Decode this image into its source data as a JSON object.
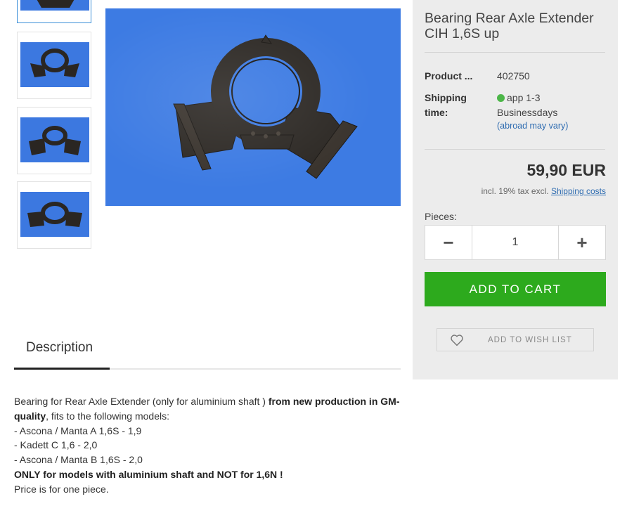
{
  "product": {
    "title": "Bearing Rear Axle Extender CIH 1,6S up",
    "number_label": "Product ...",
    "number_value": "402750",
    "shipping_label_1": "Shipping",
    "shipping_label_2": "time:",
    "shipping_value_1": "app 1-3",
    "shipping_value_2": "Businessdays",
    "shipping_note": "(abroad may vary)",
    "price": "59,90 EUR",
    "tax_text": "incl. 19% tax excl.",
    "shipping_costs_link": "Shipping costs",
    "pieces_label": "Pieces:",
    "quantity": "1",
    "minus": "−",
    "plus": "+",
    "add_to_cart": "ADD TO CART",
    "wish_list": "ADD TO WISH LIST",
    "availability_color": "#4cb648",
    "accent_color": "#2daa1d"
  },
  "tabs": {
    "description": "Description"
  },
  "description": {
    "p1_plain": "Bearing for Rear Axle Extender (only for aluminium shaft ) ",
    "p1_bold": "from new production in GM-quality",
    "p1_tail": ", fits to the following models:",
    "line2": "- Ascona / Manta A 1,6S - 1,9",
    "line3": "- Kadett C 1,6 - 2,0",
    "line4": "- Ascona / Manta B 1,6S - 2,0",
    "line5_bold": "ONLY for models with aluminium shaft and NOT for 1,6N !",
    "line6": "Price is for one piece."
  }
}
